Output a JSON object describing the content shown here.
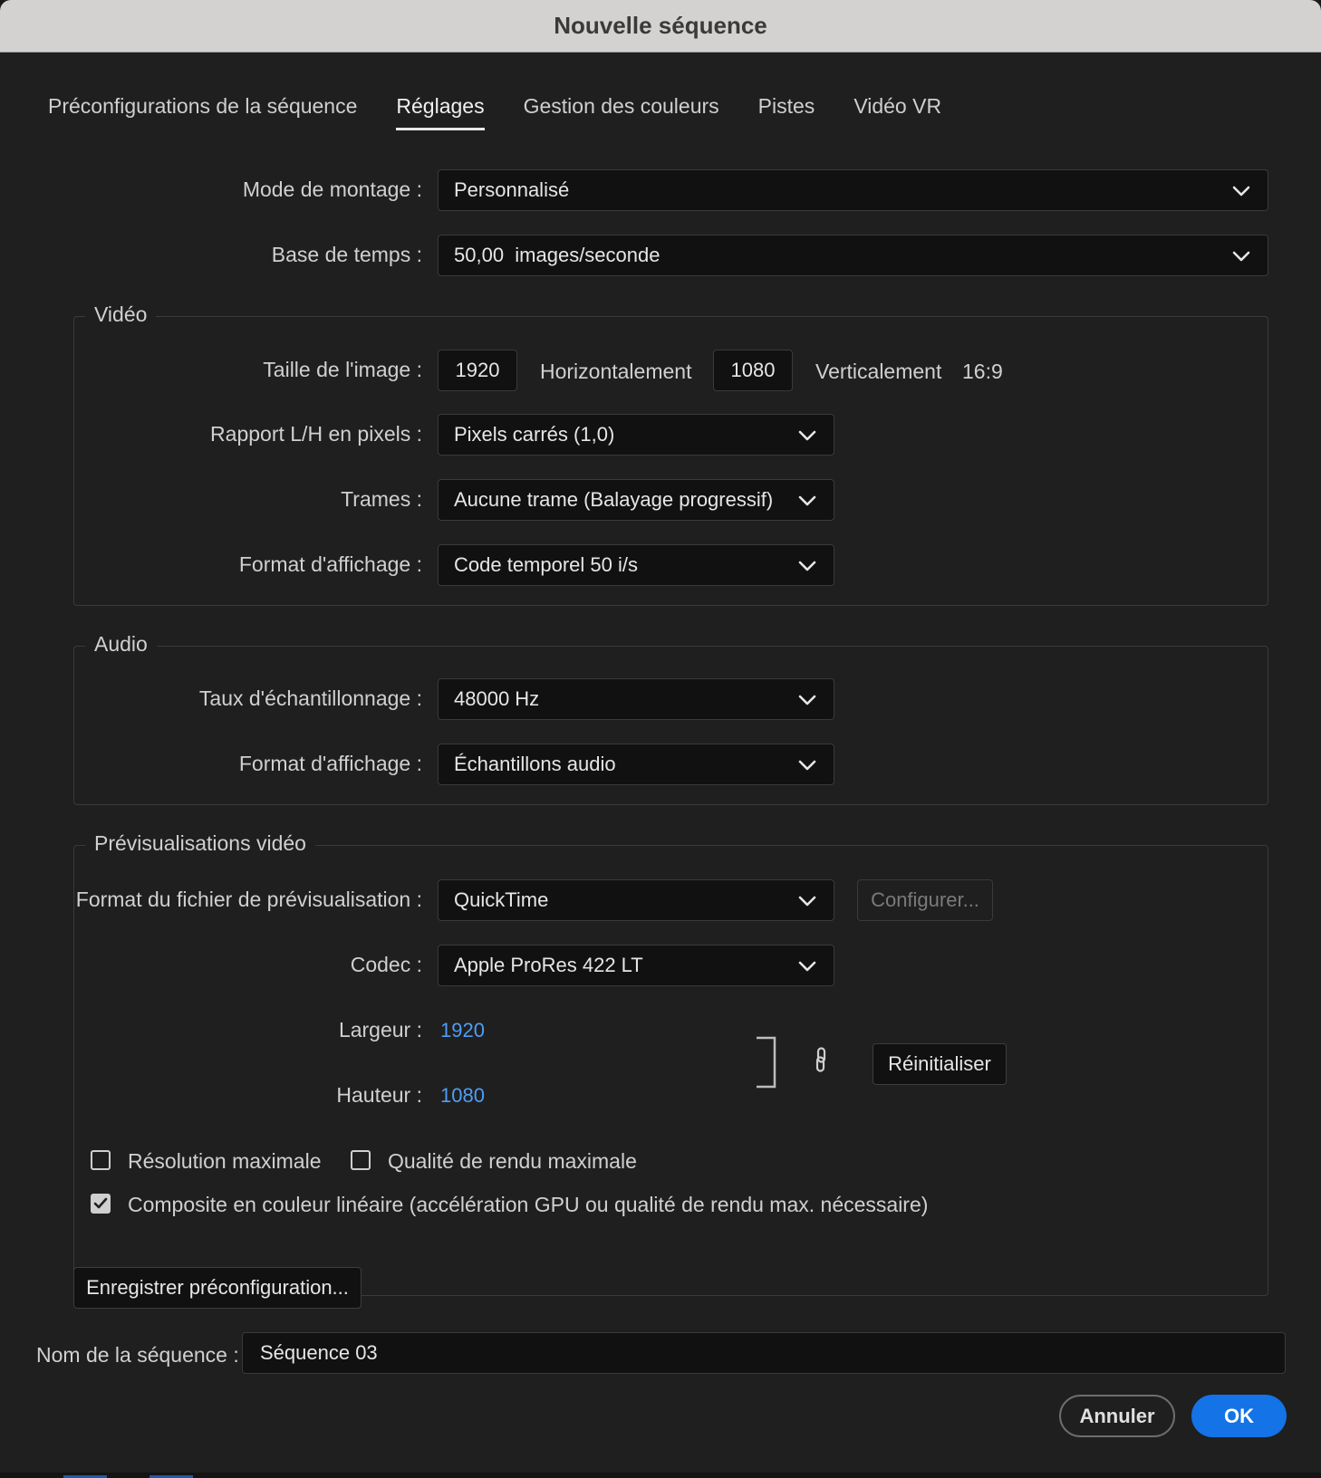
{
  "window": {
    "title": "Nouvelle séquence"
  },
  "tabs": [
    {
      "label": "Préconfigurations de la séquence",
      "active": false
    },
    {
      "label": "Réglages",
      "active": true
    },
    {
      "label": "Gestion des couleurs",
      "active": false
    },
    {
      "label": "Pistes",
      "active": false
    },
    {
      "label": "Vidéo VR",
      "active": false
    }
  ],
  "settings": {
    "editing_mode": {
      "label": "Mode de montage :",
      "value": "Personnalisé"
    },
    "timebase": {
      "label": "Base de temps :",
      "value": "50,00  images/seconde"
    }
  },
  "video": {
    "title": "Vidéo",
    "frame_size": {
      "label": "Taille de l'image :",
      "horizontal_value": "1920",
      "horizontal_label": "Horizontalement",
      "vertical_value": "1080",
      "vertical_label": "Verticalement",
      "ratio": "16:9"
    },
    "pixel_aspect": {
      "label": "Rapport L/H en pixels :",
      "value": "Pixels carrés (1,0)"
    },
    "fields": {
      "label": "Trames :",
      "value": "Aucune trame (Balayage progressif)"
    },
    "display_format": {
      "label": "Format d'affichage :",
      "value": "Code temporel 50 i/s"
    }
  },
  "audio": {
    "title": "Audio",
    "sample_rate": {
      "label": "Taux d'échantillonnage :",
      "value": "48000 Hz"
    },
    "display_format": {
      "label": "Format d'affichage :",
      "value": "Échantillons audio"
    }
  },
  "previews": {
    "title": "Prévisualisations vidéo",
    "file_format": {
      "label": "Format du fichier de prévisualisation :",
      "value": "QuickTime"
    },
    "configure_label": "Configurer...",
    "codec": {
      "label": "Codec :",
      "value": "Apple ProRes 422 LT"
    },
    "width": {
      "label": "Largeur :",
      "value": "1920"
    },
    "height": {
      "label": "Hauteur :",
      "value": "1080"
    },
    "reset_label": "Réinitialiser",
    "max_resolution": {
      "label": "Résolution maximale",
      "checked": false
    },
    "max_render_quality": {
      "label": "Qualité de rendu maximale",
      "checked": false
    },
    "linear_color": {
      "label": "Composite en couleur linéaire (accélération GPU ou qualité de rendu max. nécessaire)",
      "checked": true
    }
  },
  "save_preset_label": "Enregistrer préconfiguration...",
  "sequence_name": {
    "label": "Nom de la séquence :",
    "value": "Séquence 03"
  },
  "footer": {
    "cancel_label": "Annuler",
    "ok_label": "OK"
  },
  "colors": {
    "accent": "#1473e6",
    "link": "#4e9ef5",
    "background": "#1f1f1f",
    "titlebar": "#d4d2d0"
  },
  "icons": {
    "dropdown": "chevron-down-icon",
    "link": "link-icon",
    "check": "checkmark-icon"
  }
}
